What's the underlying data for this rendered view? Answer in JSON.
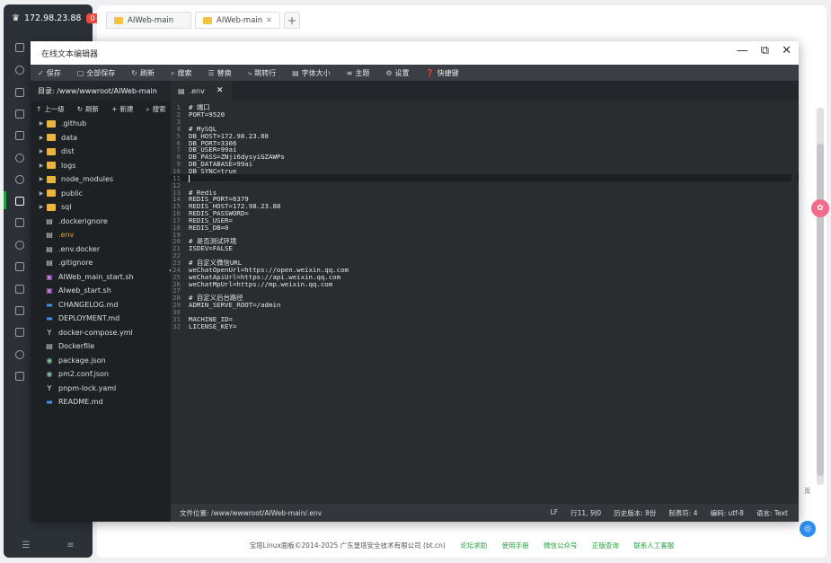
{
  "sidebar": {
    "server_ip": "172.98.23.88",
    "badge": "0"
  },
  "bg": {
    "tabs": [
      {
        "label": "AIWeb-main"
      },
      {
        "label": "AIWeb-main"
      }
    ],
    "plus": "+",
    "footer": {
      "copyright": "宝塔Linux面板©2014-2025 广东堡塔安全技术有限公司 (bt.cn)",
      "links": [
        "论坛求助",
        "使用手册",
        "微信公众号",
        "正版查询",
        "联系人工客服"
      ]
    },
    "right_label": "页"
  },
  "modal": {
    "title": "在线文本编辑器",
    "toolbar": [
      {
        "icon": "check-icon",
        "glyph": "✓",
        "label": "保存"
      },
      {
        "icon": "save-all-icon",
        "glyph": "▢",
        "label": "全部保存"
      },
      {
        "icon": "refresh-icon",
        "glyph": "↻",
        "label": "刷新"
      },
      {
        "icon": "search-icon",
        "glyph": "⌕",
        "label": "搜索"
      },
      {
        "icon": "replace-icon",
        "glyph": "☰",
        "label": "替换"
      },
      {
        "icon": "goto-line-icon",
        "glyph": "⤷",
        "label": "跳转行"
      },
      {
        "icon": "font-size-icon",
        "glyph": "▤",
        "label": "字体大小"
      },
      {
        "icon": "theme-icon",
        "glyph": "≡",
        "label": "主题"
      },
      {
        "icon": "gear-icon",
        "glyph": "⚙",
        "label": "设置"
      },
      {
        "icon": "help-icon",
        "glyph": "❓",
        "label": "快捷键"
      }
    ],
    "tree": {
      "path": "目录: /www/wwwroot/AIWeb-main",
      "actions": [
        {
          "glyph": "↑",
          "label": "上一级"
        },
        {
          "glyph": "↻",
          "label": "刷新"
        },
        {
          "glyph": "+",
          "label": "新建"
        },
        {
          "glyph": "⌕",
          "label": "搜索"
        }
      ],
      "items": [
        {
          "type": "dir",
          "label": ".github"
        },
        {
          "type": "dir",
          "label": "data"
        },
        {
          "type": "dir",
          "label": "dist"
        },
        {
          "type": "dir",
          "label": "logs"
        },
        {
          "type": "dir",
          "label": "node_modules"
        },
        {
          "type": "dir",
          "label": "public"
        },
        {
          "type": "dir",
          "label": "sql"
        },
        {
          "type": "file",
          "icon": "file-icon",
          "glyph": "▤",
          "color": "#cfd3d8",
          "label": ".dockerignore"
        },
        {
          "type": "file",
          "icon": "file-icon",
          "glyph": "▤",
          "color": "#cfd3d8",
          "label": ".env",
          "active": true
        },
        {
          "type": "file",
          "icon": "file-icon",
          "glyph": "▤",
          "color": "#cfd3d8",
          "label": ".env.docker"
        },
        {
          "type": "file",
          "icon": "file-icon",
          "glyph": "▤",
          "color": "#cfd3d8",
          "label": ".gitignore"
        },
        {
          "type": "file",
          "icon": "shell-icon",
          "glyph": "▣",
          "color": "#c678dd",
          "label": "AIWeb_main_start.sh"
        },
        {
          "type": "file",
          "icon": "shell-icon",
          "glyph": "▣",
          "color": "#c678dd",
          "label": "AIweb_start.sh"
        },
        {
          "type": "file",
          "icon": "markdown-icon",
          "glyph": "▬",
          "color": "#4a90e2",
          "label": "CHANGELOG.md"
        },
        {
          "type": "file",
          "icon": "markdown-icon",
          "glyph": "▬",
          "color": "#4a90e2",
          "label": "DEPLOYMENT.md"
        },
        {
          "type": "file",
          "icon": "yaml-icon",
          "glyph": "Y",
          "color": "#e8e8e8",
          "label": "docker-compose.yml"
        },
        {
          "type": "file",
          "icon": "file-icon",
          "glyph": "▤",
          "color": "#cfd3d8",
          "label": "Dockerfile"
        },
        {
          "type": "file",
          "icon": "json-icon",
          "glyph": "◉",
          "color": "#7ec699",
          "label": "package.json"
        },
        {
          "type": "file",
          "icon": "json-icon",
          "glyph": "◉",
          "color": "#7ec699",
          "label": "pm2.conf.json"
        },
        {
          "type": "file",
          "icon": "yaml-icon",
          "glyph": "Y",
          "color": "#e8e8e8",
          "label": "pnpm-lock.yaml"
        },
        {
          "type": "file",
          "icon": "markdown-icon",
          "glyph": "▬",
          "color": "#4a90e2",
          "label": "README.md"
        }
      ]
    },
    "editor": {
      "tab_label": ".env",
      "tab_close": "✕",
      "current_line": 11,
      "lines": [
        "# 端口",
        "PORT=9520",
        "",
        "# MySQL",
        "DB_HOST=172.98.23.88",
        "DB_PORT=3306",
        "DB_USER=99ai",
        "DB_PASS=ZNji6dysyiGZAWPs",
        "DB_DATABASE=99ai",
        "DB_SYNC=true",
        "",
        "",
        "# Redis",
        "REDIS_PORT=6379",
        "REDIS_HOST=172.98.23.88",
        "REDIS_PASSWORD=",
        "REDIS_USER=",
        "REDIS_DB=0",
        "",
        "# 是否测试环境",
        "ISDEV=FALSE",
        "",
        "# 自定义微信URL",
        "weChatOpenUrl=https://open.weixin.qq.com",
        "weChatApiUrl=https://api.weixin.qq.com",
        "weChatMpUrl=https://mp.weixin.qq.com",
        "",
        "# 自定义后台路径",
        "ADMIN_SERVE_ROOT=/admin",
        "",
        "MACHINE_ID=",
        "LICENSE_KEY="
      ]
    },
    "status": {
      "location": "文件位置: /www/wwwroot/AIWeb-main/.env",
      "eol": "LF",
      "cursor": "行11, 列0",
      "history": "历史版本: 8份",
      "tab": "制表符: 4",
      "encoding": "编码: utf-8",
      "language": "语言: Text"
    }
  },
  "colors": {
    "accent_green": "#20a53a",
    "toolbar_bg": "#3b3f45",
    "editor_bg": "#2a2c2e",
    "tree_bg": "#1e2124"
  }
}
